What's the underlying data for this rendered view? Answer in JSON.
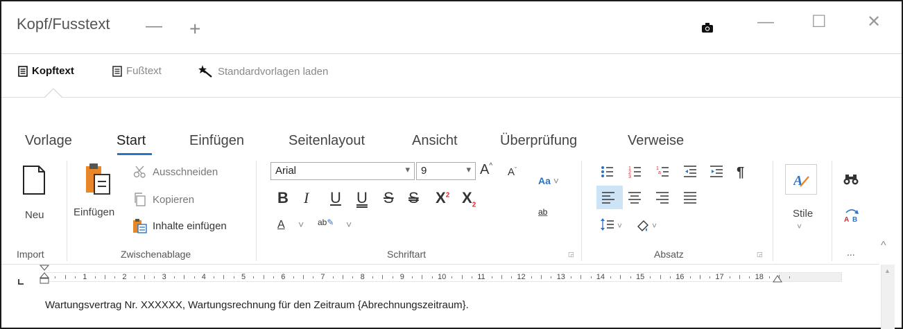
{
  "window": {
    "title": "Kopf/Fusstext",
    "minimize_glyph": "—",
    "add_glyph": "+",
    "camera_icon": "camera-icon",
    "win_minimize": "—",
    "win_maximize": "☐",
    "win_close": "✕"
  },
  "subtabs": {
    "kopftext": "Kopftext",
    "fusstext": "Fußtext",
    "standardvorlagen": "Standardvorlagen laden"
  },
  "menu": {
    "items": [
      "Vorlage",
      "Start",
      "Einfügen",
      "Seitenlayout",
      "Ansicht",
      "Überprüfung",
      "Verweise"
    ],
    "active": "Start"
  },
  "ribbon": {
    "import": {
      "neu": "Neu",
      "group": "Import"
    },
    "clipboard": {
      "einfuegen": "Einfügen",
      "ausschneiden": "Ausschneiden",
      "kopieren": "Kopieren",
      "inhalte_einfuegen": "Inhalte einfügen",
      "group": "Zwischenablage"
    },
    "font": {
      "family": "Arial",
      "size": "9",
      "grow": "A",
      "shrink": "A",
      "case": "Aa",
      "bold": "B",
      "italic": "I",
      "underline": "U",
      "double_underline": "U",
      "strike": "S",
      "double_strike": "S",
      "superscript": "X",
      "subscript": "X",
      "sup_mark": "2",
      "sub_mark": "2",
      "font_color": "A",
      "highlight": "ab",
      "clear_format": "ab",
      "group": "Schriftart"
    },
    "paragraph": {
      "group": "Absatz"
    },
    "styles": {
      "stile": "Stile"
    },
    "misc": {
      "group": "..."
    }
  },
  "ruler": {
    "numbers": [
      "1",
      "2",
      "3",
      "4",
      "5",
      "6",
      "7",
      "8",
      "9",
      "10",
      "11",
      "12",
      "13",
      "14",
      "15",
      "16",
      "17",
      "18"
    ]
  },
  "document": {
    "text": "Wartungsvertrag Nr. XXXXXX, Wartungsrechnung für den Zeitraum {Abrechnungszeitraum}."
  },
  "colors": {
    "accent": "#2b73c4",
    "border": "#1a1a1a",
    "red": "#d62b2b",
    "align_selected": "#cde4f7"
  }
}
